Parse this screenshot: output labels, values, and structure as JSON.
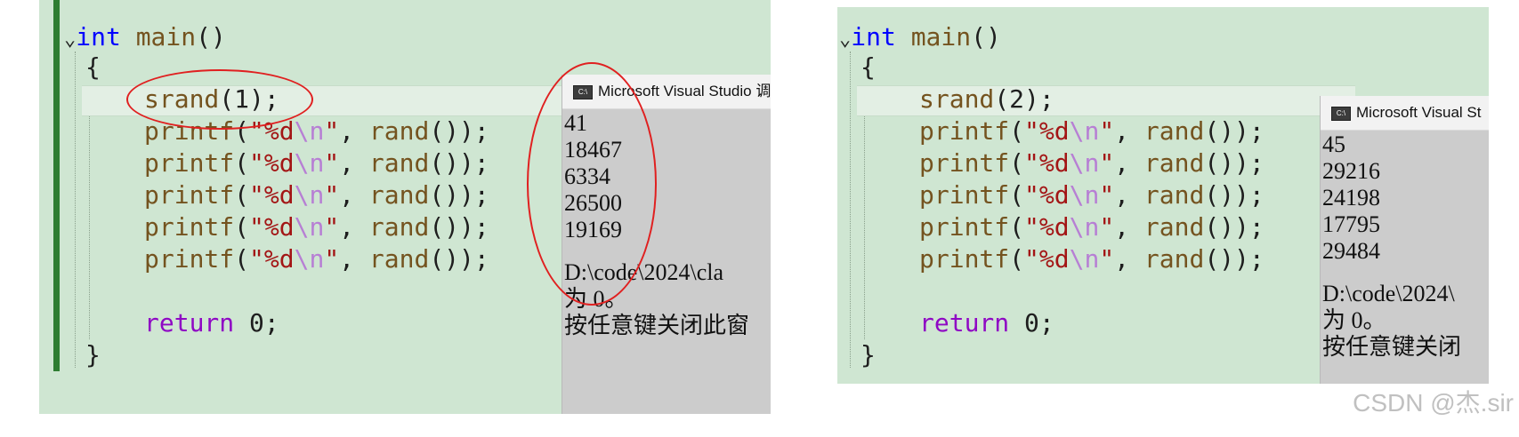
{
  "left": {
    "code": {
      "l1_kw": "int",
      "l1_fn": "main",
      "l1_rest": "()",
      "open_brace": "{",
      "srand_fn": "srand",
      "srand_open": "(",
      "srand_arg": "1",
      "srand_close": ");",
      "printf_fn": "printf",
      "printf_open": "(",
      "fmt_str": "\"%d",
      "fmt_esc": "\\n",
      "fmt_end": "\"",
      "comma": ", ",
      "rand_fn": "rand",
      "rand_tail": "());",
      "return_kw": "return",
      "return_val": "0",
      "semicolon": ";",
      "close_brace": "}"
    },
    "console": {
      "title": "Microsoft Visual Studio 调",
      "outputs": [
        "41",
        "18467",
        "6334",
        "26500",
        "19169"
      ],
      "path_line": "D:\\code\\2024\\cla",
      "exit_line": "为 0。",
      "press_key_line": "按任意键关闭此窗"
    }
  },
  "right": {
    "code": {
      "l1_kw": "int",
      "l1_fn": "main",
      "l1_rest": "()",
      "open_brace": "{",
      "srand_fn": "srand",
      "srand_open": "(",
      "srand_arg": "2",
      "srand_close": ");",
      "printf_fn": "printf",
      "printf_open": "(",
      "fmt_str": "\"%d",
      "fmt_esc": "\\n",
      "fmt_end": "\"",
      "comma": ", ",
      "rand_fn": "rand",
      "rand_tail": "());",
      "return_kw": "return",
      "return_val": "0",
      "semicolon": ";",
      "close_brace": "}"
    },
    "console": {
      "title": "Microsoft Visual St",
      "outputs": [
        "45",
        "29216",
        "24198",
        "17795",
        "29484"
      ],
      "path_line": "D:\\code\\2024\\",
      "exit_line": "为 0。",
      "press_key_line": "按任意键关闭"
    }
  },
  "icons": {
    "fold": "chevron-down-icon",
    "console_app": "vs-console-icon"
  },
  "icon_glyphs": {
    "chevron": "⌄",
    "console_app": "C:\\"
  },
  "annotation_color": "#e02020",
  "watermark": "CSDN @杰.sir"
}
